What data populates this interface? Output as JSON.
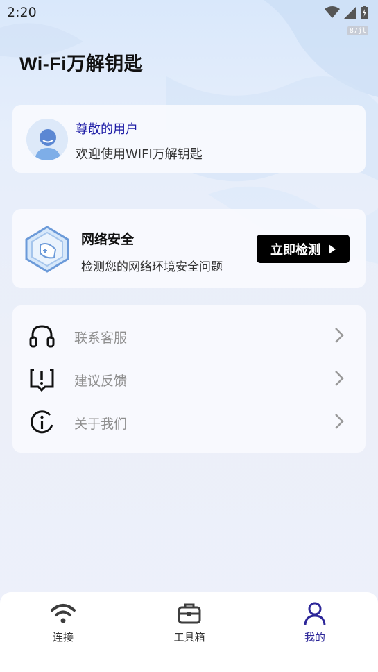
{
  "status_bar": {
    "time": "2:20",
    "badge": "87jl",
    "icons": [
      "wifi-signal-icon",
      "cell-signal-icon",
      "battery-charging-icon"
    ]
  },
  "app_title": "Wi-Fi万解钥匙",
  "user_card": {
    "name": "尊敬的用户",
    "welcome": "欢迎使用WIFI万解钥匙",
    "avatar_icon": "user-avatar-icon"
  },
  "security_card": {
    "title": "网络安全",
    "subtitle": "检测您的网络环境安全问题",
    "button_label": "立即检测",
    "icon": "shield-icon"
  },
  "menu": [
    {
      "label": "联系客服",
      "icon": "headset-icon"
    },
    {
      "label": "建议反馈",
      "icon": "feedback-icon"
    },
    {
      "label": "关于我们",
      "icon": "info-icon"
    }
  ],
  "bottom_nav": [
    {
      "label": "连接",
      "icon": "wifi-icon",
      "active": false
    },
    {
      "label": "工具箱",
      "icon": "toolbox-icon",
      "active": false
    },
    {
      "label": "我的",
      "icon": "person-icon",
      "active": true
    }
  ],
  "colors": {
    "accent": "#2d2799",
    "user_name": "#1d1ca6",
    "button_bg": "#000000"
  }
}
